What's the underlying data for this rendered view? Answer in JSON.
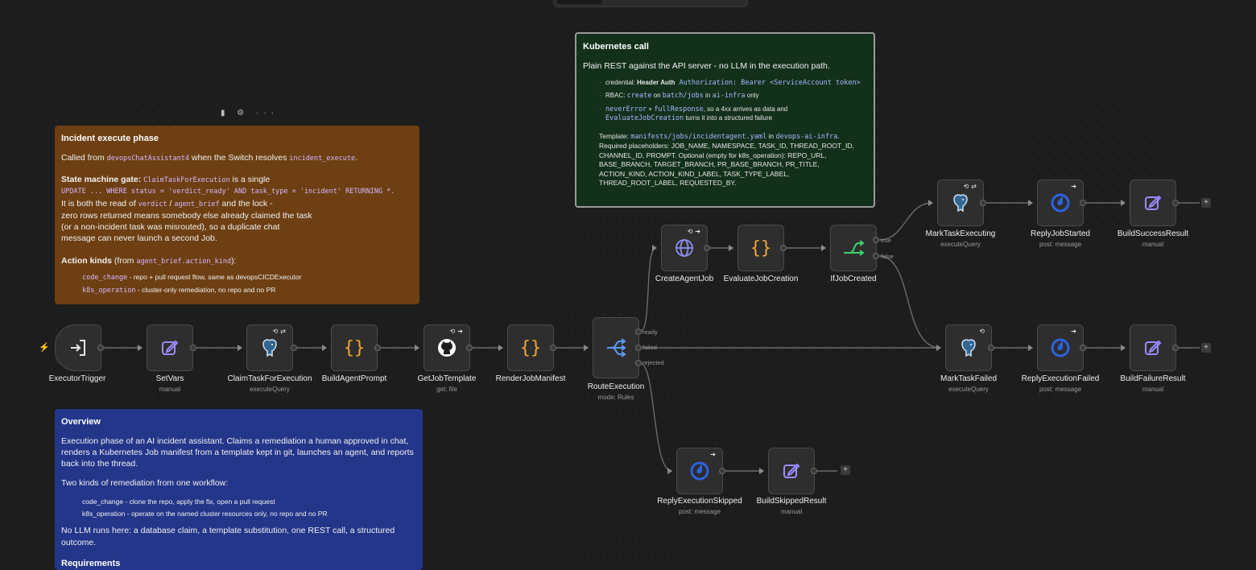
{
  "toolbar": {
    "note_controls": "▮ ⚙ ···"
  },
  "notes": {
    "incident": {
      "title": "Incident execute phase",
      "line1_pre": "Called from ",
      "line1_code": "devopsChatAssistant4",
      "line1_mid": " when the Switch resolves ",
      "line1_code2": "incident_execute",
      "line1_end": ".",
      "gate_label": "State machine gate:",
      "gate_code": "ClaimTaskForExecution",
      "gate_text": " is a single",
      "gate_sql": "UPDATE ... WHERE status = 'verdict_ready' AND task_type = 'incident' RETURNING *.",
      "read_pre": "It is both the read of ",
      "read_code1": "verdict",
      "read_sep": " / ",
      "read_code2": "agent_brief",
      "read_post": " and the lock -",
      "zero1": "zero rows returned means somebody else already claimed the task",
      "zero2": "(or a non-incident task was misrouted), so a duplicate chat",
      "zero3": "message can never launch a second Job.",
      "action_label": "Action kinds",
      "action_pre": " (from ",
      "action_code": "agent_brief.action_kind",
      "action_post": "):",
      "kind1_code": "code_change",
      "kind1_text": " - repo + pull request flow, same as devopsCICDExecutor",
      "kind2_code": "k8s_operation",
      "kind2_text": " - cluster-only remediation, no repo and no PR"
    },
    "overview": {
      "title": "Overview",
      "p1": "Execution phase of an AI incident assistant. Claims a remediation a human approved in chat, renders a Kubernetes Job manifest from a template kept in git, launches an agent, and reports back into the thread.",
      "p2": "Two kinds of remediation from one workflow:",
      "kind1": "code_change - clone the repo, apply the fix, open a pull request",
      "kind2": "k8s_operation - operate on the named cluster resources only, no repo and no PR",
      "p3": "No LLM runs here: a database claim, a template substitution, one REST call, a structured outcome.",
      "req": "Requirements"
    },
    "k8s": {
      "title": "Kubernetes call",
      "p1": "Plain REST against the API server - no LLM in the execution path.",
      "cred_pre": "credential: ",
      "cred_bold": "Header Auth",
      "cred_code": " Authorization: Bearer <ServiceAccount token>",
      "rbac_pre": "RBAC: ",
      "rbac_c1": "create",
      "rbac_on": " on ",
      "rbac_c2": "batch/jobs",
      "rbac_in": " in ",
      "rbac_c3": "ai-infra",
      "rbac_post": " only",
      "ne_c1": "neverError",
      "ne_plus": " + ",
      "ne_c2": "fullResponse",
      "ne_post": ", so a 4xx arrives as data and",
      "ne_c3": "EvaluateJobCreation",
      "ne_post2": " turns it into a structured failure",
      "tpl_pre": "Template: ",
      "tpl_c1": "manifests/jobs/incidentagent.yaml",
      "tpl_in": " in ",
      "tpl_c2": "devops-ai-infra",
      "tpl_end": ".",
      "tpl_body": "Required placeholders: JOB_NAME, NAMESPACE, TASK_ID, THREAD_ROOT_ID, CHANNEL_ID, PROMPT. Optional (empty for k8s_operation): REPO_URL, BASE_BRANCH, TARGET_BRANCH, PR_BASE_BRANCH, PR_TITLE, ACTION_KIND, ACTION_KIND_LABEL, TASK_TYPE_LABEL, THREAD_ROOT_LABEL, REQUESTED_BY."
    }
  },
  "nodes": {
    "executor_trigger": {
      "label": "ExecutorTrigger"
    },
    "set_vars": {
      "label": "SetVars",
      "sub": "manual"
    },
    "claim_task": {
      "label": "ClaimTaskForExecution",
      "sub": "executeQuery"
    },
    "build_prompt": {
      "label": "BuildAgentPrompt"
    },
    "get_template": {
      "label": "GetJobTemplate",
      "sub": "get: file"
    },
    "render_manifest": {
      "label": "RenderJobManifest"
    },
    "route_execution": {
      "label": "RouteExecution",
      "sub": "mode: Rules",
      "out_ready": "ready",
      "out_failed": "failed",
      "out_rejected": "rejected"
    },
    "create_job": {
      "label": "CreateAgentJob"
    },
    "evaluate_job": {
      "label": "EvaluateJobCreation"
    },
    "if_job_created": {
      "label": "IfJobCreated",
      "out_true": "true",
      "out_false": "false"
    },
    "mark_executing": {
      "label": "MarkTaskExecuting",
      "sub": "executeQuery"
    },
    "reply_started": {
      "label": "ReplyJobStarted",
      "sub": "post: message"
    },
    "build_success": {
      "label": "BuildSuccessResult",
      "sub": "manual"
    },
    "mark_failed": {
      "label": "MarkTaskFailed",
      "sub": "executeQuery"
    },
    "reply_failed": {
      "label": "ReplyExecutionFailed",
      "sub": "post: message"
    },
    "build_failure": {
      "label": "BuildFailureResult",
      "sub": "manual"
    },
    "reply_skipped": {
      "label": "ReplyExecutionSkipped",
      "sub": "post: message"
    },
    "build_skipped": {
      "label": "BuildSkippedResult",
      "sub": "manual"
    }
  },
  "icons": {
    "trigger": "sign-in-icon",
    "set": "pencil-square-icon",
    "postgres": "postgres-elephant-icon",
    "code": "curly-braces-icon",
    "github": "github-icon",
    "switch": "switch-branch-icon",
    "http": "globe-icon",
    "if": "if-branch-icon",
    "mattermost": "mattermost-icon"
  },
  "colors": {
    "canvas": "#1d1d1d",
    "note_brown": "#6d3f12",
    "note_blue": "#24368a",
    "note_green": "#13301b",
    "code_orange": "#f0a83a",
    "set_purple": "#9b8cff",
    "trigger_orange": "#ff6d2e",
    "if_green": "#3ccf6e",
    "mattermost_blue": "#2d62e0"
  }
}
